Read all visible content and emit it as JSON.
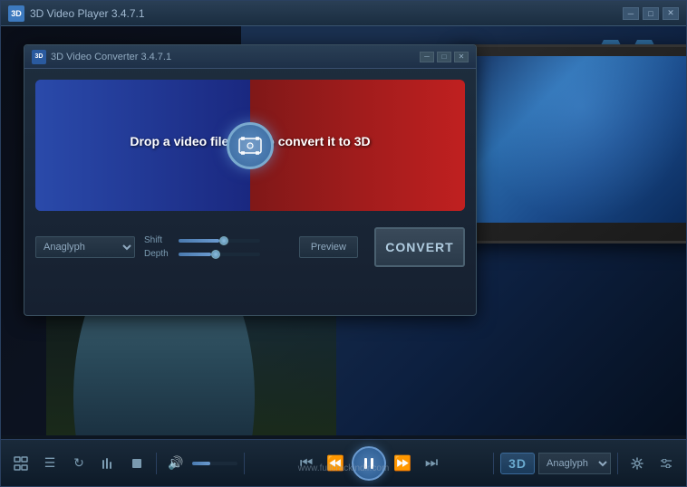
{
  "outer_window": {
    "title": "3D Video Player 3.4.7.1",
    "title_icon_label": "3D"
  },
  "dialog": {
    "title": "3D Video Converter 3.4.7.1",
    "title_icon_label": "3D",
    "drop_text": "Drop a video file here to convert it to 3D",
    "controls": {
      "anaglyph_label": "Anaglyph",
      "shift_label": "Shift",
      "depth_label": "Depth",
      "preview_label": "Preview",
      "convert_label": "CONVERT"
    },
    "window_buttons": {
      "minimize": "─",
      "maximize": "□",
      "close": "✕"
    }
  },
  "outer_window_buttons": {
    "minimize": "─",
    "maximize": "□",
    "close": "✕"
  },
  "bottom_toolbar": {
    "three_d_label": "3D",
    "anaglyph_label": "Anaglyph",
    "website": "www.fullcrackindir.com"
  },
  "sliders": {
    "shift_value": 50,
    "depth_value": 40,
    "volume_value": 40
  }
}
